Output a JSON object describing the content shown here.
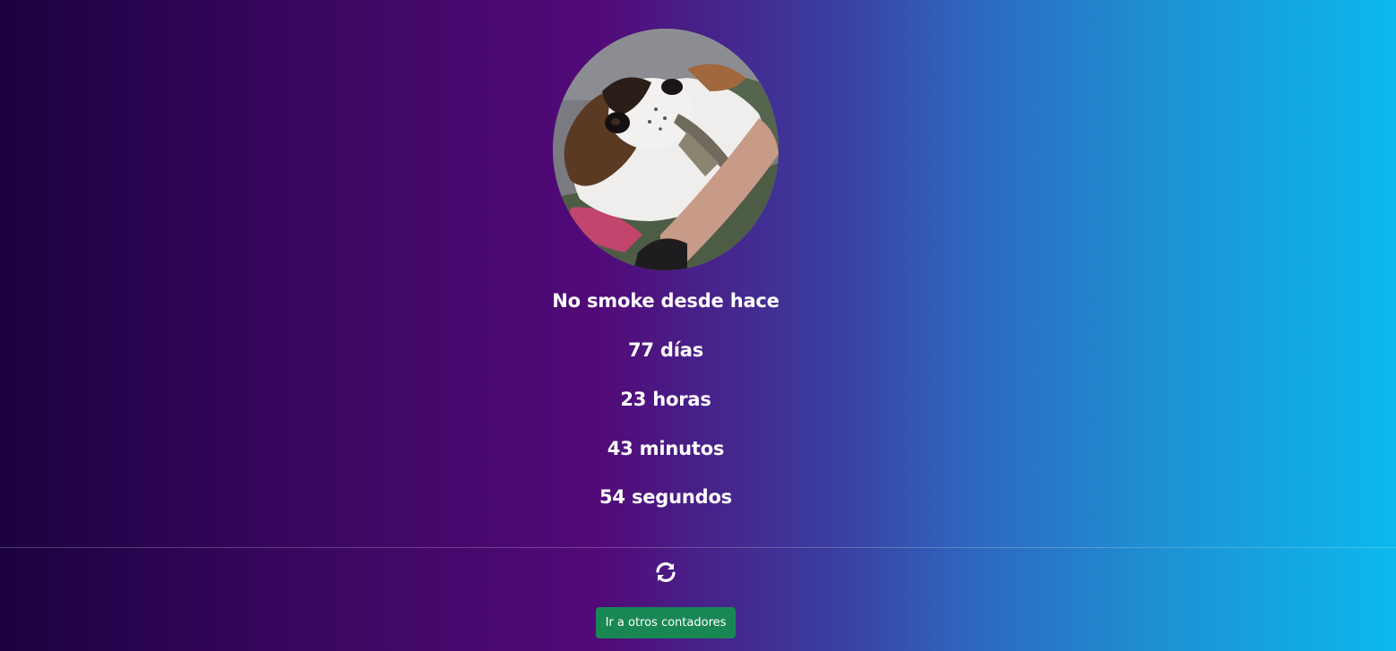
{
  "profile": {
    "photo_description": "dog-photo"
  },
  "counter": {
    "heading": "No smoke desde hace",
    "days": "77 días",
    "hours": "23 horas",
    "minutes": "43 minutos",
    "seconds": "54 segundos"
  },
  "footer": {
    "refresh_icon": "refresh-icon",
    "button_label": "Ir a otros contadores"
  },
  "colors": {
    "gradient_left": "#1b0140",
    "gradient_mid": "#520a78",
    "gradient_right": "#0cb8ee",
    "button_bg": "#198754",
    "text": "#ffffff"
  }
}
